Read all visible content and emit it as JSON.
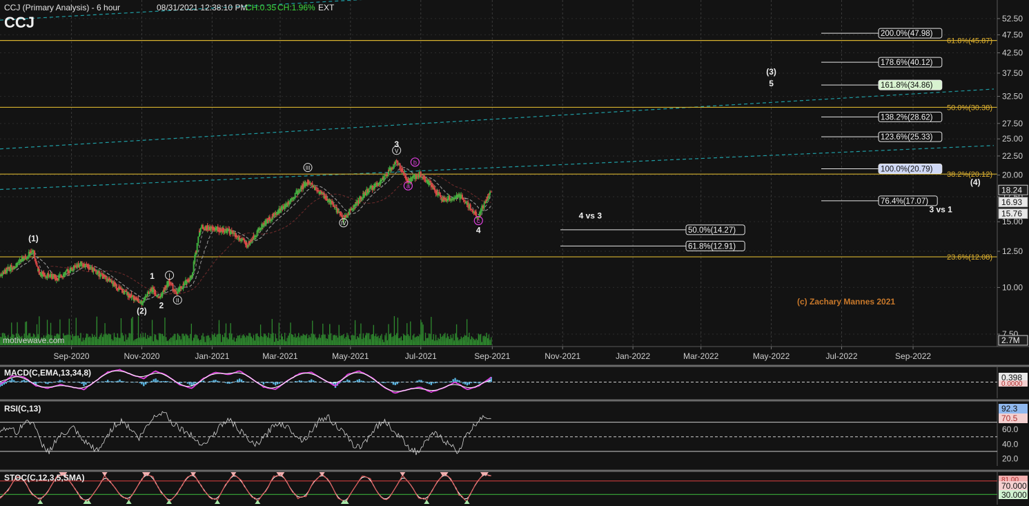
{
  "header": {
    "symbol": "CCJ",
    "title": "CCJ (Primary Analysis)  - 6 hour",
    "datetime": "08/31/2021 12:38:10 PM",
    "change": "CH:0.35",
    "change_pct": "CH:1.96%",
    "session": "EXT"
  },
  "watermark": "motivewave.com",
  "copyright": "(c) Zachary Mannes 2021",
  "colors": {
    "background": "#131313",
    "fib_line": "#d8b32f",
    "fib_label": "#e2b22f",
    "trend_channel": "#1f9ea5",
    "up_candle": "#3fb23f",
    "down_candle": "#e04848",
    "macd_line": "#e040e0",
    "macd_signal": "#ffffff",
    "macd_hist": "#5ab4e0",
    "rsi_line": "#d6d6d6",
    "stoch_k": "#e05a5a",
    "stoch_d": "#ffffff",
    "wave_magenta": "#e040e0"
  },
  "chart_data": {
    "type": "candlestick",
    "x_axis": {
      "ticks": [
        "Sep-2020",
        "Nov-2020",
        "Jan-2021",
        "Mar-2021",
        "May-2021",
        "Jul-2021",
        "Sep-2021",
        "Nov-2021",
        "Jan-2022",
        "Mar-2022",
        "May-2022",
        "Jul-2022",
        "Sep-2022"
      ],
      "range": [
        "2020-07-01",
        "2022-11-10"
      ]
    },
    "y_axis": {
      "ticks": [
        "52.50",
        "47.50",
        "42.50",
        "37.50",
        "32.50",
        "27.50",
        "25.00",
        "22.50",
        "20.00",
        "17.50",
        "15.00",
        "12.50",
        "10.00",
        "7.50"
      ],
      "scale": "log",
      "range": [
        7.5,
        55
      ]
    },
    "price_labels": [
      {
        "value": 18.24,
        "text": "18.24",
        "style": "current"
      },
      {
        "value": 16.93,
        "text": "16.93",
        "style": "ma"
      },
      {
        "value": 15.76,
        "text": "15.76",
        "style": "ma"
      }
    ],
    "volume_label": "2.7M",
    "price_path": [
      [
        "2020-07-01",
        10.8
      ],
      [
        "2020-07-15",
        11.5
      ],
      [
        "2020-07-30",
        12.5
      ],
      [
        "2020-08-04",
        10.9
      ],
      [
        "2020-08-20",
        10.6
      ],
      [
        "2020-09-10",
        11.6
      ],
      [
        "2020-09-25",
        10.9
      ],
      [
        "2020-10-15",
        9.8
      ],
      [
        "2020-11-01",
        9.1
      ],
      [
        "2020-11-10",
        9.9
      ],
      [
        "2020-11-17",
        9.4
      ],
      [
        "2020-11-25",
        10.4
      ],
      [
        "2020-12-01",
        9.6
      ],
      [
        "2020-12-15",
        10.8
      ],
      [
        "2020-12-22",
        14.5
      ],
      [
        "2021-01-15",
        14.2
      ],
      [
        "2021-02-01",
        13.0
      ],
      [
        "2021-02-15",
        14.8
      ],
      [
        "2021-03-05",
        16.5
      ],
      [
        "2021-03-25",
        19.2
      ],
      [
        "2021-04-15",
        16.8
      ],
      [
        "2021-04-25",
        15.2
      ],
      [
        "2021-05-15",
        18.0
      ],
      [
        "2021-05-30",
        19.5
      ],
      [
        "2021-06-10",
        21.8
      ],
      [
        "2021-06-20",
        19.2
      ],
      [
        "2021-07-01",
        20.2
      ],
      [
        "2021-07-20",
        17.2
      ],
      [
        "2021-08-05",
        17.5
      ],
      [
        "2021-08-20",
        15.4
      ],
      [
        "2021-08-31",
        18.2
      ]
    ],
    "fib_levels": [
      {
        "label": "61.8%(45.87)",
        "value": 45.87
      },
      {
        "label": "50.0%(30.38)",
        "value": 30.38
      },
      {
        "label": "38.2%(20.12)",
        "value": 20.12
      },
      {
        "label": "23.6%(12.08)",
        "value": 12.08
      }
    ],
    "projection_levels": [
      {
        "label": "200.0%(47.98)",
        "value": 47.98,
        "boxed": true
      },
      {
        "label": "178.6%(40.12)",
        "value": 40.12,
        "boxed": true
      },
      {
        "label": "161.8%(34.86)",
        "value": 34.86,
        "boxed": true,
        "highlight": "#d8f3d0"
      },
      {
        "label": "138.2%(28.62)",
        "value": 28.62,
        "boxed": true
      },
      {
        "label": "123.6%(25.33)",
        "value": 25.33,
        "boxed": true
      },
      {
        "label": "100.0%(20.79)",
        "value": 20.79,
        "boxed": true,
        "highlight": "#cfd8f5"
      },
      {
        "label": "76.4%(17.07)",
        "value": 17.07,
        "boxed": true
      }
    ],
    "retrace_levels": [
      {
        "label": "50.0%(14.27)",
        "value": 14.27
      },
      {
        "label": "61.8%(12.91)",
        "value": 12.91
      }
    ],
    "wave_labels": [
      {
        "text": "(1)",
        "date": "2020-07-30",
        "value": 13.3,
        "style": "plain"
      },
      {
        "text": "(2)",
        "date": "2020-11-01",
        "value": 8.5,
        "style": "plain"
      },
      {
        "text": "1",
        "date": "2020-11-10",
        "value": 10.55,
        "style": "plain"
      },
      {
        "text": "2",
        "date": "2020-11-18",
        "value": 8.8,
        "style": "plain"
      },
      {
        "text": "i",
        "date": "2020-11-25",
        "value": 10.6,
        "style": "circle"
      },
      {
        "text": "ii",
        "date": "2020-12-02",
        "value": 9.1,
        "style": "circle"
      },
      {
        "text": "iii",
        "date": "2021-03-25",
        "value": 20.6,
        "style": "circle"
      },
      {
        "text": "iv",
        "date": "2021-04-25",
        "value": 14.65,
        "style": "circle"
      },
      {
        "text": "v",
        "date": "2021-06-10",
        "value": 22.9,
        "style": "circle"
      },
      {
        "text": "3",
        "date": "2021-06-10",
        "value": 23.8,
        "style": "plain"
      },
      {
        "text": "a",
        "date": "2021-06-20",
        "value": 18.4,
        "style": "magenta"
      },
      {
        "text": "b",
        "date": "2021-06-26",
        "value": 21.3,
        "style": "magenta"
      },
      {
        "text": "c",
        "date": "2021-08-20",
        "value": 14.85,
        "style": "magenta"
      },
      {
        "text": "4",
        "date": "2021-08-20",
        "value": 14.0,
        "style": "plain"
      },
      {
        "text": "(3)",
        "date": "2022-05-01",
        "value": 37.2,
        "style": "plain"
      },
      {
        "text": "5",
        "date": "2022-05-01",
        "value": 34.6,
        "style": "plain"
      },
      {
        "text": "(4)",
        "date": "2022-10-25",
        "value": 18.8,
        "style": "plain"
      },
      {
        "text": "4 vs 3",
        "date": "2021-11-25",
        "value": 15.3,
        "style": "plain"
      },
      {
        "text": "3 vs 1",
        "date": "2022-09-25",
        "value": 15.9,
        "style": "plain"
      }
    ],
    "indicators": {
      "macd": {
        "label": "MACD(C,EMA,13,34,8)",
        "current": "0.398",
        "zero_label": "0.0000",
        "range": [
          -1.2,
          1.2
        ],
        "oscillator": [
          -0.2,
          0.5,
          0.4,
          -0.3,
          -0.5,
          -0.2,
          -0.4,
          -0.6,
          0.1,
          0.8,
          1.0,
          0.6,
          0.3,
          0.9,
          0.5,
          -0.2,
          -0.5,
          0.3,
          0.8,
          0.6,
          0.9,
          0.3,
          -0.4,
          -0.6,
          0.1,
          0.7,
          0.8,
          0.2,
          -0.3,
          0.6,
          0.9,
          0.4,
          -0.4,
          -0.9,
          -0.6,
          -0.4,
          -0.8,
          -0.5,
          0.0,
          -0.6,
          -0.3,
          0.4
        ]
      },
      "rsi": {
        "label": "RSI(C,13)",
        "current": "92.3",
        "marker": "70.5",
        "ticks": [
          "60.0",
          "40.0",
          "20.0"
        ],
        "range": [
          10,
          100
        ],
        "values": [
          58,
          64,
          55,
          70,
          72,
          40,
          30,
          48,
          55,
          62,
          45,
          38,
          30,
          50,
          66,
          72,
          60,
          48,
          65,
          80,
          85,
          70,
          62,
          55,
          45,
          40,
          52,
          66,
          74,
          62,
          50,
          38,
          45,
          60,
          70,
          64,
          55,
          44,
          58,
          72,
          78,
          66,
          55,
          40,
          35,
          50,
          64,
          72,
          60,
          48,
          36,
          28,
          42,
          55,
          48,
          38,
          30,
          52,
          66,
          80,
          75
        ]
      },
      "stochastic": {
        "label": "STOC(C,12,3,5,SMA)",
        "current": "81.00",
        "upper": "70.000",
        "lower": "30.000",
        "range": [
          0,
          100
        ],
        "values": [
          20,
          40,
          85,
          70,
          30,
          15,
          40,
          80,
          90,
          60,
          20,
          10,
          45,
          85,
          60,
          25,
          15,
          50,
          90,
          80,
          35,
          10,
          30,
          75,
          90,
          55,
          20,
          15,
          60,
          88,
          70,
          30,
          12,
          40,
          82,
          90,
          50,
          18,
          25,
          70,
          92,
          65,
          20,
          10,
          50,
          85,
          75,
          30,
          12,
          45,
          88,
          60,
          22,
          15,
          55,
          90,
          78,
          30,
          10,
          60,
          92,
          85
        ]
      }
    }
  }
}
